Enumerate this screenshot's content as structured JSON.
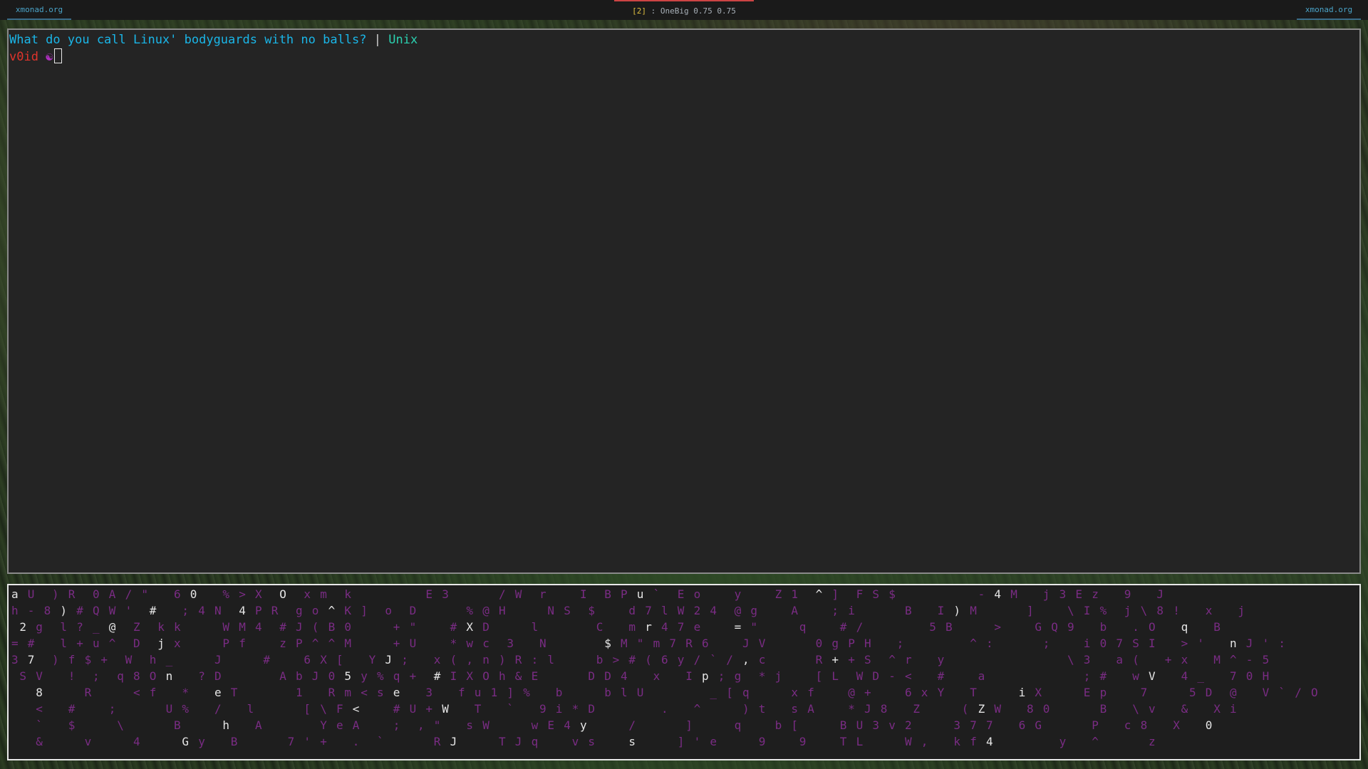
{
  "topbar": {
    "left_label": "xmonad.org",
    "right_label": "xmonad.org",
    "workspace": "[2]",
    "layout_info": ": OneBig 0.75 0.75"
  },
  "terminal": {
    "joke_text": "What do you call Linux' bodyguards with no balls?",
    "separator": "|",
    "answer": "Unix",
    "prompt_user": "v0id",
    "prompt_symbol": "☯"
  },
  "matrix": {
    "dim_color": "#7a2c84",
    "bright_color": "#e6e6e6",
    "rows": [
      "a U  ) R  0 A / \"   6 0   % > X  O  x m  k         E 3      / W  r    I  B P u `  E o    y    Z 1  ^ ]  F S $          - 4 M   j 3 E z   9   J",
      "h - 8 ) # Q W '  #   ; 4 N  4 P R  g o ^ K ]  o  D      % @ H     N S  $    d 7 l W 2 4  @ g    A    ; i      B   I ) M      ]    \\ I %  j \\ 8 !   x   j",
      " 2 g  l ? _ @  Z  k k     W M 4  # J ( B 0     + \"    # X D     l       C   m r 4 7 e    = \"     q    # /        5 B     >    G Q 9   b   . O   q   B",
      "= #   l + u ^  D  j x     P f    z P ^ ^ M     + U    * w c  3   N       $ M \" m 7 R 6    J V      0 g P H   ;        ^ :      ;    i 0 7 S I   > '   n J ' :",
      "3 7  ) f $ +  W  h _     J     #    6 X [   Y J ;   x ( , n ) R : l     b > # ( 6 y / ` / , c      R + + S  ^ r   y               \\ 3   a (   + x   M ^ - 5",
      " S V   !  ;  q 8 O n   ? D       A b J 0 5 y % q +  # I X O h & E      D D 4   x   I p ; g  * j    [ L  W D - <   #    a            ; #   w V   4 _   7 0 H",
      "   8     R     < f   *   e T       1   R m < s e   3   f u 1 ] %   b     b l U        _ [ q     x f    @ +    6 x Y   T     i X     E p    7     5 D  @   V ` / O",
      "   <   #    ;      U %   /   l      [ \\ F <    # U + W   T   `   9 i * D        .   ^     ) t   s A    * J 8   Z     ( Z W   8 0      B   \\ v   &   X i",
      "   `   $     \\      B     h   A       Y e A    ;  , \"   s W     w E 4 y     /      ]     q    b [     B U 3 v 2     3 7 7   6 G      P   c 8   X   0",
      "   &     v     4     G y   B      7 ' +   .  `      R J     T J q    v s    s     ] ' e     9    9    T L     W ,   k f 4        y   ^      z"
    ]
  }
}
